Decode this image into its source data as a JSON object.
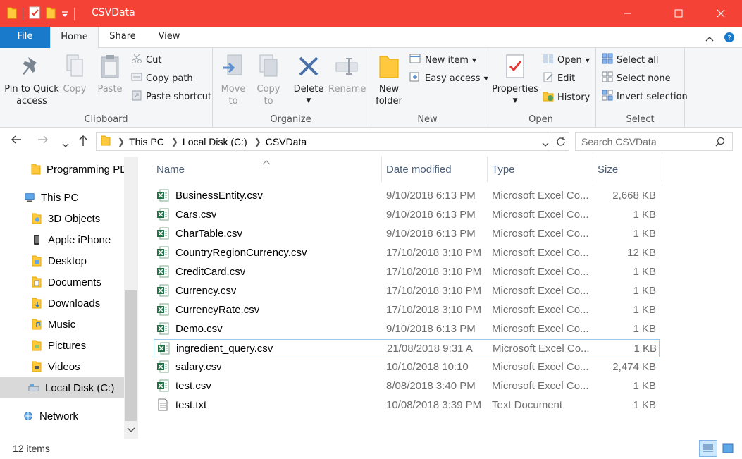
{
  "window": {
    "title": "CSVData",
    "minimize": "minimize",
    "maximize": "maximize",
    "close": "close"
  },
  "ribbon_tabs": {
    "file": "File",
    "home": "Home",
    "share": "Share",
    "view": "View"
  },
  "clipboard": {
    "pin": [
      "Pin to Quick",
      "access"
    ],
    "copy": "Copy",
    "paste": "Paste",
    "cut": "Cut",
    "copy_path": "Copy path",
    "paste_shortcut": "Paste shortcut",
    "label": "Clipboard"
  },
  "organize": {
    "move_to": [
      "Move",
      "to"
    ],
    "copy_to": [
      "Copy",
      "to"
    ],
    "delete": "Delete",
    "rename": "Rename",
    "label": "Organize"
  },
  "new": {
    "new_folder": [
      "New",
      "folder"
    ],
    "new_item": "New item",
    "easy_access": "Easy access",
    "label": "New"
  },
  "open": {
    "properties": "Properties",
    "open": "Open",
    "edit": "Edit",
    "history": "History",
    "label": "Open"
  },
  "select": {
    "select_all": "Select all",
    "select_none": "Select none",
    "invert": "Invert selection",
    "label": "Select"
  },
  "address": {
    "crumbs": [
      "This PC",
      "Local Disk (C:)",
      "CSVData"
    ],
    "search_placeholder": "Search CSVData"
  },
  "nav": {
    "items": [
      {
        "label": "Programming PDF",
        "icon": "folder-icon"
      },
      {
        "label": "This PC",
        "icon": "pc-icon"
      },
      {
        "label": "3D Objects",
        "icon": "3d-objects-icon"
      },
      {
        "label": "Apple iPhone",
        "icon": "phone-icon"
      },
      {
        "label": "Desktop",
        "icon": "desktop-icon"
      },
      {
        "label": "Documents",
        "icon": "documents-icon"
      },
      {
        "label": "Downloads",
        "icon": "downloads-icon"
      },
      {
        "label": "Music",
        "icon": "music-icon"
      },
      {
        "label": "Pictures",
        "icon": "pictures-icon"
      },
      {
        "label": "Videos",
        "icon": "videos-icon"
      },
      {
        "label": "Local Disk (C:)",
        "icon": "disk-icon"
      },
      {
        "label": "Network",
        "icon": "network-icon"
      }
    ]
  },
  "columns": {
    "name": "Name",
    "date": "Date modified",
    "type": "Type",
    "size": "Size"
  },
  "files": [
    {
      "name": "BusinessEntity.csv",
      "date": "9/10/2018 6:13 PM",
      "type": "Microsoft Excel Co...",
      "size": "2,668 KB",
      "icon": "excel-icon"
    },
    {
      "name": "Cars.csv",
      "date": "9/10/2018 6:13 PM",
      "type": "Microsoft Excel Co...",
      "size": "1 KB",
      "icon": "excel-icon"
    },
    {
      "name": "CharTable.csv",
      "date": "9/10/2018 6:13 PM",
      "type": "Microsoft Excel Co...",
      "size": "1 KB",
      "icon": "excel-icon"
    },
    {
      "name": "CountryRegionCurrency.csv",
      "date": "17/10/2018 3:10 PM",
      "type": "Microsoft Excel Co...",
      "size": "12 KB",
      "icon": "excel-icon"
    },
    {
      "name": "CreditCard.csv",
      "date": "17/10/2018 3:10 PM",
      "type": "Microsoft Excel Co...",
      "size": "1 KB",
      "icon": "excel-icon"
    },
    {
      "name": "Currency.csv",
      "date": "17/10/2018 3:10 PM",
      "type": "Microsoft Excel Co...",
      "size": "1 KB",
      "icon": "excel-icon"
    },
    {
      "name": "CurrencyRate.csv",
      "date": "17/10/2018 3:10 PM",
      "type": "Microsoft Excel Co...",
      "size": "1 KB",
      "icon": "excel-icon"
    },
    {
      "name": "Demo.csv",
      "date": "9/10/2018 6:13 PM",
      "type": "Microsoft Excel Co...",
      "size": "1 KB",
      "icon": "excel-icon"
    },
    {
      "name": "ingredient_query.csv",
      "date": "21/08/2018 9:31 A",
      "type": "Microsoft Excel Co...",
      "size": "1 KB",
      "icon": "excel-icon"
    },
    {
      "name": "salary.csv",
      "date": "10/10/2018 10:10",
      "type": "Microsoft Excel Co...",
      "size": "2,474 KB",
      "icon": "excel-icon"
    },
    {
      "name": "test.csv",
      "date": "8/08/2018 3:40 PM",
      "type": "Microsoft Excel Co...",
      "size": "1 KB",
      "icon": "excel-icon"
    },
    {
      "name": "test.txt",
      "date": "10/08/2018 3:39 PM",
      "type": "Text Document",
      "size": "1 KB",
      "icon": "text-file-icon"
    }
  ],
  "status": {
    "count": "12 items"
  },
  "colors": {
    "title_bar": "#f44336",
    "file_tab": "#1979ca",
    "excel_green": "#1e7145",
    "folder_yellow": "#ffc83d"
  }
}
